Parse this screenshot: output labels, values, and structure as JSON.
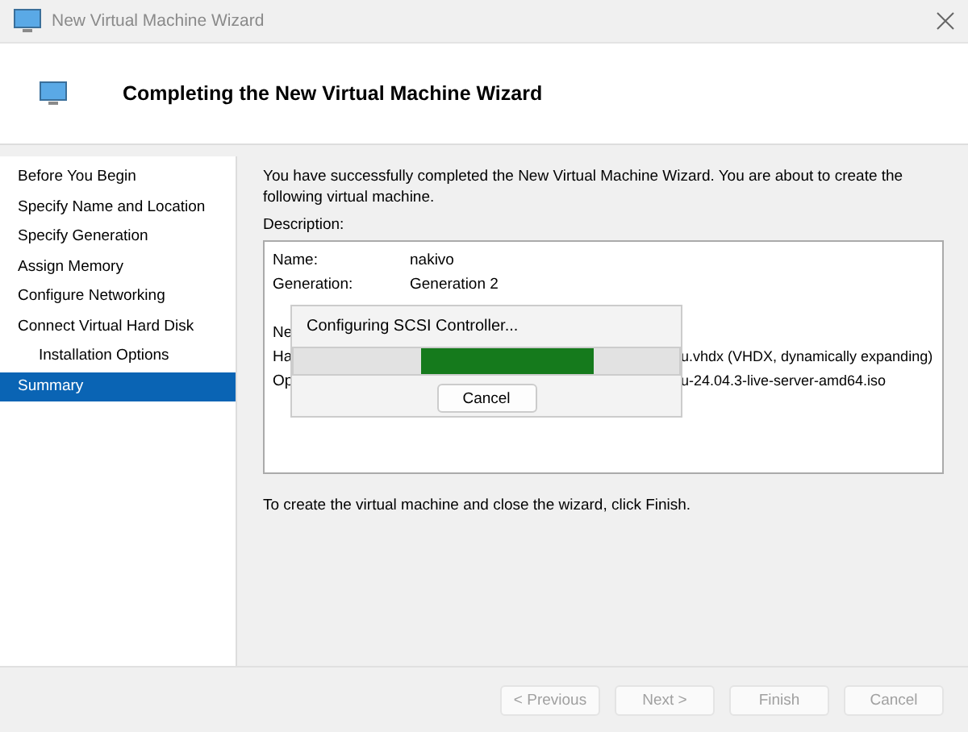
{
  "window": {
    "title": "New Virtual Machine Wizard"
  },
  "header": {
    "title": "Completing the New Virtual Machine Wizard"
  },
  "sidebar": {
    "items": [
      {
        "label": "Before You Begin",
        "selected": false
      },
      {
        "label": "Specify Name and Location",
        "selected": false
      },
      {
        "label": "Specify Generation",
        "selected": false
      },
      {
        "label": "Assign Memory",
        "selected": false
      },
      {
        "label": "Configure Networking",
        "selected": false
      },
      {
        "label": "Connect Virtual Hard Disk",
        "selected": false,
        "children": [
          {
            "label": "Installation Options",
            "selected": false
          }
        ]
      },
      {
        "label": "Summary",
        "selected": true
      }
    ]
  },
  "intro": "You have successfully completed the New Virtual Machine Wizard. You are about to create the following virtual machine.",
  "description_label": "Description:",
  "description_rows": [
    {
      "kind": "full",
      "label": "Name:",
      "value": "nakivo"
    },
    {
      "kind": "full",
      "label": "Generation:",
      "value": "Generation 2"
    },
    {
      "kind": "covered",
      "label": "Ne"
    },
    {
      "kind": "covered",
      "label": "Ha",
      "value_tail": "u.vhdx (VHDX, dynamically expanding)"
    },
    {
      "kind": "covered",
      "label": "Op",
      "value_tail": "u-24.04.3-live-server-amd64.iso"
    }
  ],
  "progress_dialog": {
    "message": "Configuring SCSI Controller...",
    "cancel": "Cancel"
  },
  "footer_note": "To create the virtual machine and close the wizard, click Finish.",
  "buttons": [
    {
      "label": "< Previous",
      "disabled": true
    },
    {
      "label": "Next >",
      "disabled": true
    },
    {
      "label": "Finish",
      "disabled": true
    },
    {
      "label": "Cancel",
      "disabled": true
    }
  ]
}
